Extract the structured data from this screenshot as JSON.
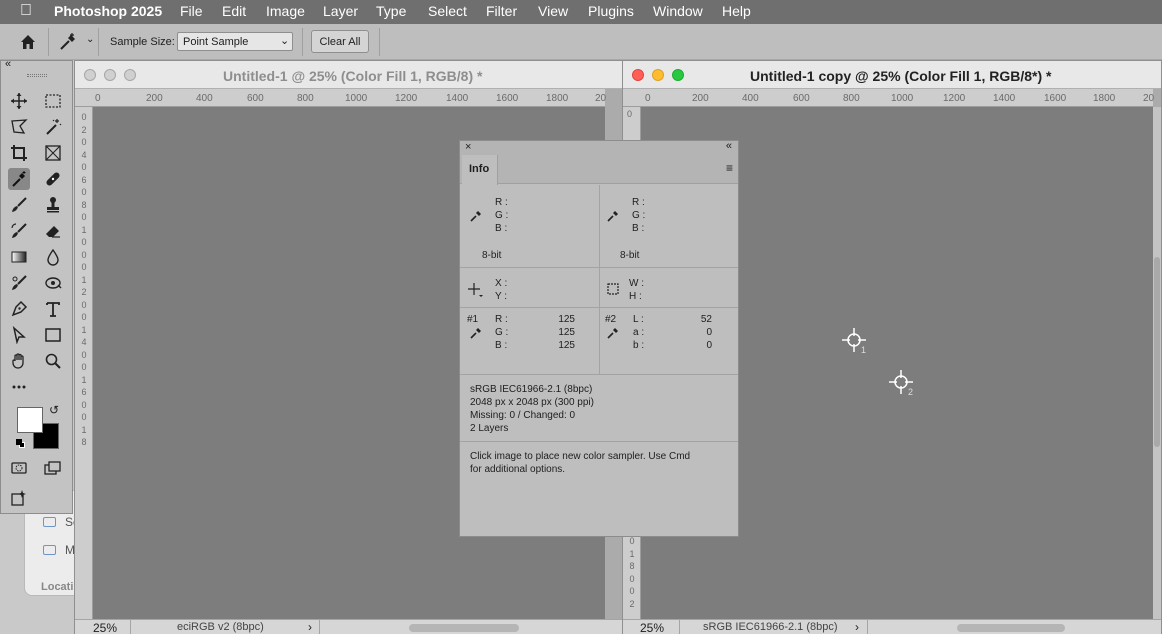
{
  "menubar": {
    "app_name": "Photoshop 2025",
    "items": [
      "File",
      "Edit",
      "Image",
      "Layer",
      "Type",
      "Select",
      "Filter",
      "View",
      "Plugins",
      "Window",
      "Help"
    ]
  },
  "options_bar": {
    "sample_size_label": "Sample Size:",
    "sample_size_value": "Point Sample",
    "clear_all": "Clear All"
  },
  "finder_fragment": {
    "items": [
      "Sc",
      "M"
    ],
    "section": "Locati"
  },
  "doc1": {
    "title": "Untitled-1 @ 25% (Color Fill 1, RGB/8) *",
    "ruler_ticks": [
      "0",
      "200",
      "400",
      "600",
      "800",
      "1000",
      "1200",
      "1400",
      "1600",
      "1800",
      "20"
    ],
    "vruler": [
      "0",
      "2",
      "0",
      "4",
      "0",
      "6",
      "0",
      "8",
      "0",
      "1",
      "0",
      "0",
      "0",
      "1",
      "2",
      "0",
      "0",
      "1",
      "4",
      "0",
      "0",
      "1",
      "6",
      "0",
      "0",
      "1",
      "8"
    ],
    "zoom": "25%",
    "status": "eciRGB v2 (8bpc)"
  },
  "doc2": {
    "title": "Untitled-1 copy @ 25% (Color Fill 1, RGB/8*) *",
    "ruler_ticks": [
      "0",
      "200",
      "400",
      "600",
      "800",
      "1000",
      "1200",
      "1400",
      "1600",
      "1800",
      "20"
    ],
    "vruler_top": "0",
    "vruler_bottom": [
      "0",
      "1",
      "8",
      "0",
      "0",
      "2"
    ],
    "zoom": "25%",
    "status": "sRGB IEC61966-2.1 (8bpc)",
    "samplers": [
      "1",
      "2"
    ]
  },
  "info_panel": {
    "tab": "Info",
    "r_label": "R :",
    "g_label": "G :",
    "b_label": "B :",
    "bit_left": "8-bit",
    "bit_right": "8-bit",
    "x_label": "X :",
    "y_label": "Y :",
    "w_label": "W :",
    "h_label": "H :",
    "sampler1": {
      "id": "#1",
      "r": "125",
      "g": "125",
      "b": "125"
    },
    "sampler2": {
      "id": "#2",
      "l_label": "L :",
      "a_label": "a :",
      "b_label": "b :",
      "l": "52",
      "a": "0",
      "b": "0"
    },
    "doc_info": [
      "sRGB IEC61966-2.1 (8bpc)",
      "2048 px x 2048 px (300 ppi)",
      "Missing: 0 / Changed: 0",
      "2 Layers"
    ],
    "hint_line1": "Click image to place new color sampler.  Use Cmd",
    "hint_line2": "for additional options."
  },
  "colors": {
    "menubar": "#6f6f6f",
    "canvas": "#7d7d7d",
    "panel": "#bebebe",
    "foreground": "#ffffff",
    "background": "#000000"
  }
}
